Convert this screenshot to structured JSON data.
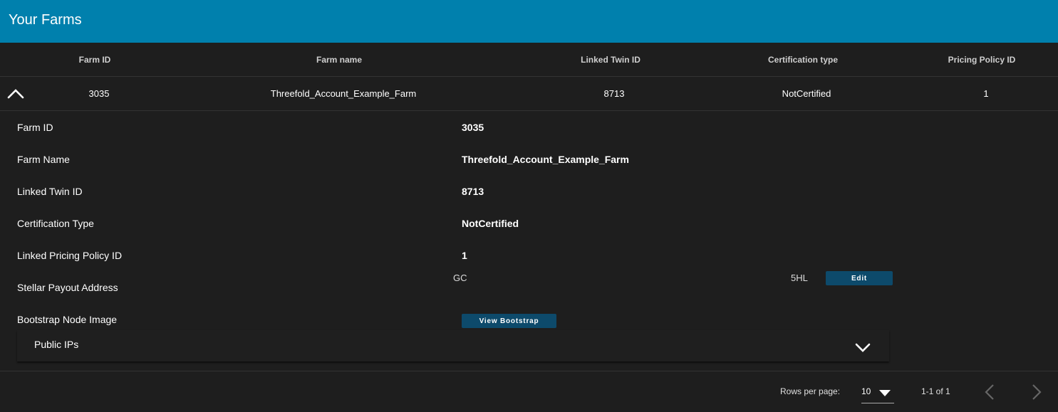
{
  "header": {
    "title": "Your Farms"
  },
  "table": {
    "columns": [
      "Farm ID",
      "Farm name",
      "Linked Twin ID",
      "Certification type",
      "Pricing Policy ID"
    ],
    "row": {
      "farm_id": "3035",
      "farm_name": "Threefold_Account_Example_Farm",
      "linked_twin_id": "8713",
      "certification_type": "NotCertified",
      "pricing_policy_id": "1"
    }
  },
  "details": {
    "farm_id_label": "Farm ID",
    "farm_id_value": "3035",
    "farm_name_label": "Farm Name",
    "farm_name_value": "Threefold_Account_Example_Farm",
    "twin_label": "Linked Twin ID",
    "twin_value": "8713",
    "cert_label": "Certification Type",
    "cert_value": "NotCertified",
    "pricing_label": "Linked Pricing Policy ID",
    "pricing_value": "1",
    "stellar_label": "Stellar Payout Address",
    "stellar_prefix": "GC",
    "stellar_suffix": "5HL",
    "edit_label": "Edit",
    "bootstrap_label": "Bootstrap Node Image",
    "view_bootstrap_label": "View Bootstrap"
  },
  "public_ips": {
    "label": "Public IPs",
    "icon": "chevron-down-icon"
  },
  "footer": {
    "rows_per_page_label": "Rows per page:",
    "rows_per_page_value": "10",
    "range_text": "1-1 of 1"
  },
  "colors": {
    "header": "#0080ad",
    "background": "#1e1e1e",
    "button": "#0d4a6b"
  }
}
